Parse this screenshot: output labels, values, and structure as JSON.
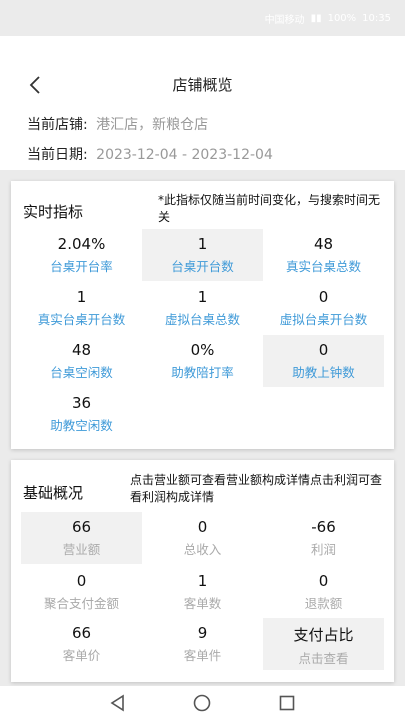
{
  "status": {
    "carrier": "中国移动",
    "battery": "100%",
    "time": "10:35"
  },
  "header": {
    "title": "店铺概览",
    "store_label": "当前店铺:",
    "store_value": "港汇店，新粮仓店",
    "date_label": "当前日期:",
    "date_value": "2023-12-04 - 2023-12-04"
  },
  "realtime": {
    "title": "实时指标",
    "note": "*此指标仅随当前时间变化，与搜索时间无关",
    "items": [
      {
        "value": "2.04%",
        "label": "台桌开台率"
      },
      {
        "value": "1",
        "label": "台桌开台数"
      },
      {
        "value": "48",
        "label": "真实台桌总数"
      },
      {
        "value": "1",
        "label": "真实台桌开台数"
      },
      {
        "value": "1",
        "label": "虚拟台桌总数"
      },
      {
        "value": "0",
        "label": "虚拟台桌开台数"
      },
      {
        "value": "48",
        "label": "台桌空闲数"
      },
      {
        "value": "0%",
        "label": "助教陪打率"
      },
      {
        "value": "0",
        "label": "助教上钟数"
      },
      {
        "value": "36",
        "label": "助教空闲数"
      }
    ]
  },
  "basic": {
    "title": "基础概况",
    "note": "点击营业额可查看营业额构成详情点击利润可查看利润构成详情",
    "items": [
      {
        "value": "66",
        "label": "营业额"
      },
      {
        "value": "0",
        "label": "总收入"
      },
      {
        "value": "-66",
        "label": "利润"
      },
      {
        "value": "0",
        "label": "聚合支付金额"
      },
      {
        "value": "1",
        "label": "客单数"
      },
      {
        "value": "0",
        "label": "退款额"
      },
      {
        "value": "66",
        "label": "客单价"
      },
      {
        "value": "9",
        "label": "客单件"
      },
      {
        "value": "支付占比",
        "label": "点击查看"
      }
    ]
  }
}
